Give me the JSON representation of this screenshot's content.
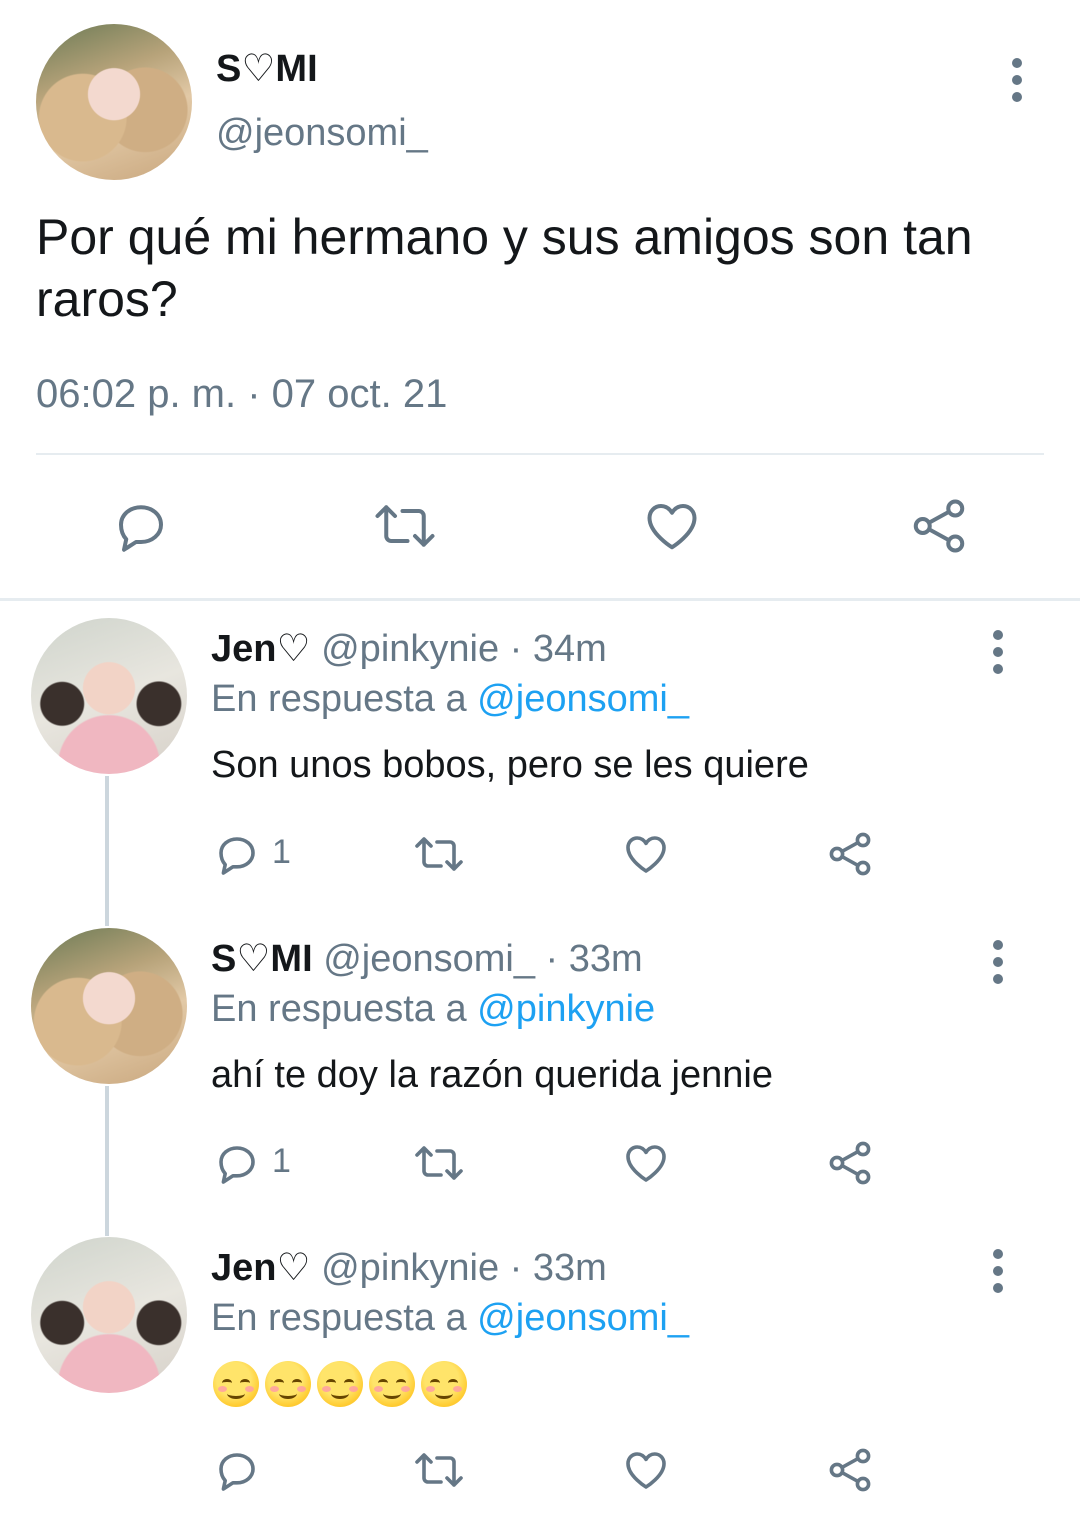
{
  "main_tweet": {
    "display_name": "S♡MI",
    "handle": "@jeonsomi_",
    "text": "Por qué mi hermano y sus amigos son tan raros?",
    "timestamp": "06:02 p. m. · 07 oct. 21"
  },
  "replies": [
    {
      "display_name": "Jen♡",
      "handle": "@pinkynie",
      "time": "· 34m",
      "reply_prefix": "En respuesta a",
      "reply_to": "@jeonsomi_",
      "text": "Son unos bobos, pero se les quiere",
      "reply_count": "1"
    },
    {
      "display_name": "S♡MI",
      "handle": "@jeonsomi_",
      "time": "· 33m",
      "reply_prefix": "En respuesta a",
      "reply_to": "@pinkynie",
      "text": "ahí te doy la razón querida jennie",
      "reply_count": "1"
    },
    {
      "display_name": "Jen♡",
      "handle": "@pinkynie",
      "time": "· 33m",
      "reply_prefix": "En respuesta a",
      "reply_to": "@jeonsomi_",
      "text": "☺☺☺☺☺",
      "reply_count": ""
    }
  ],
  "icons": [
    "reply-icon",
    "retweet-icon",
    "like-icon",
    "share-icon",
    "more-options-icon"
  ],
  "colors": {
    "text": "#14171a",
    "secondary": "#657786",
    "link": "#1da1f2",
    "divider": "#e6ecf0"
  }
}
